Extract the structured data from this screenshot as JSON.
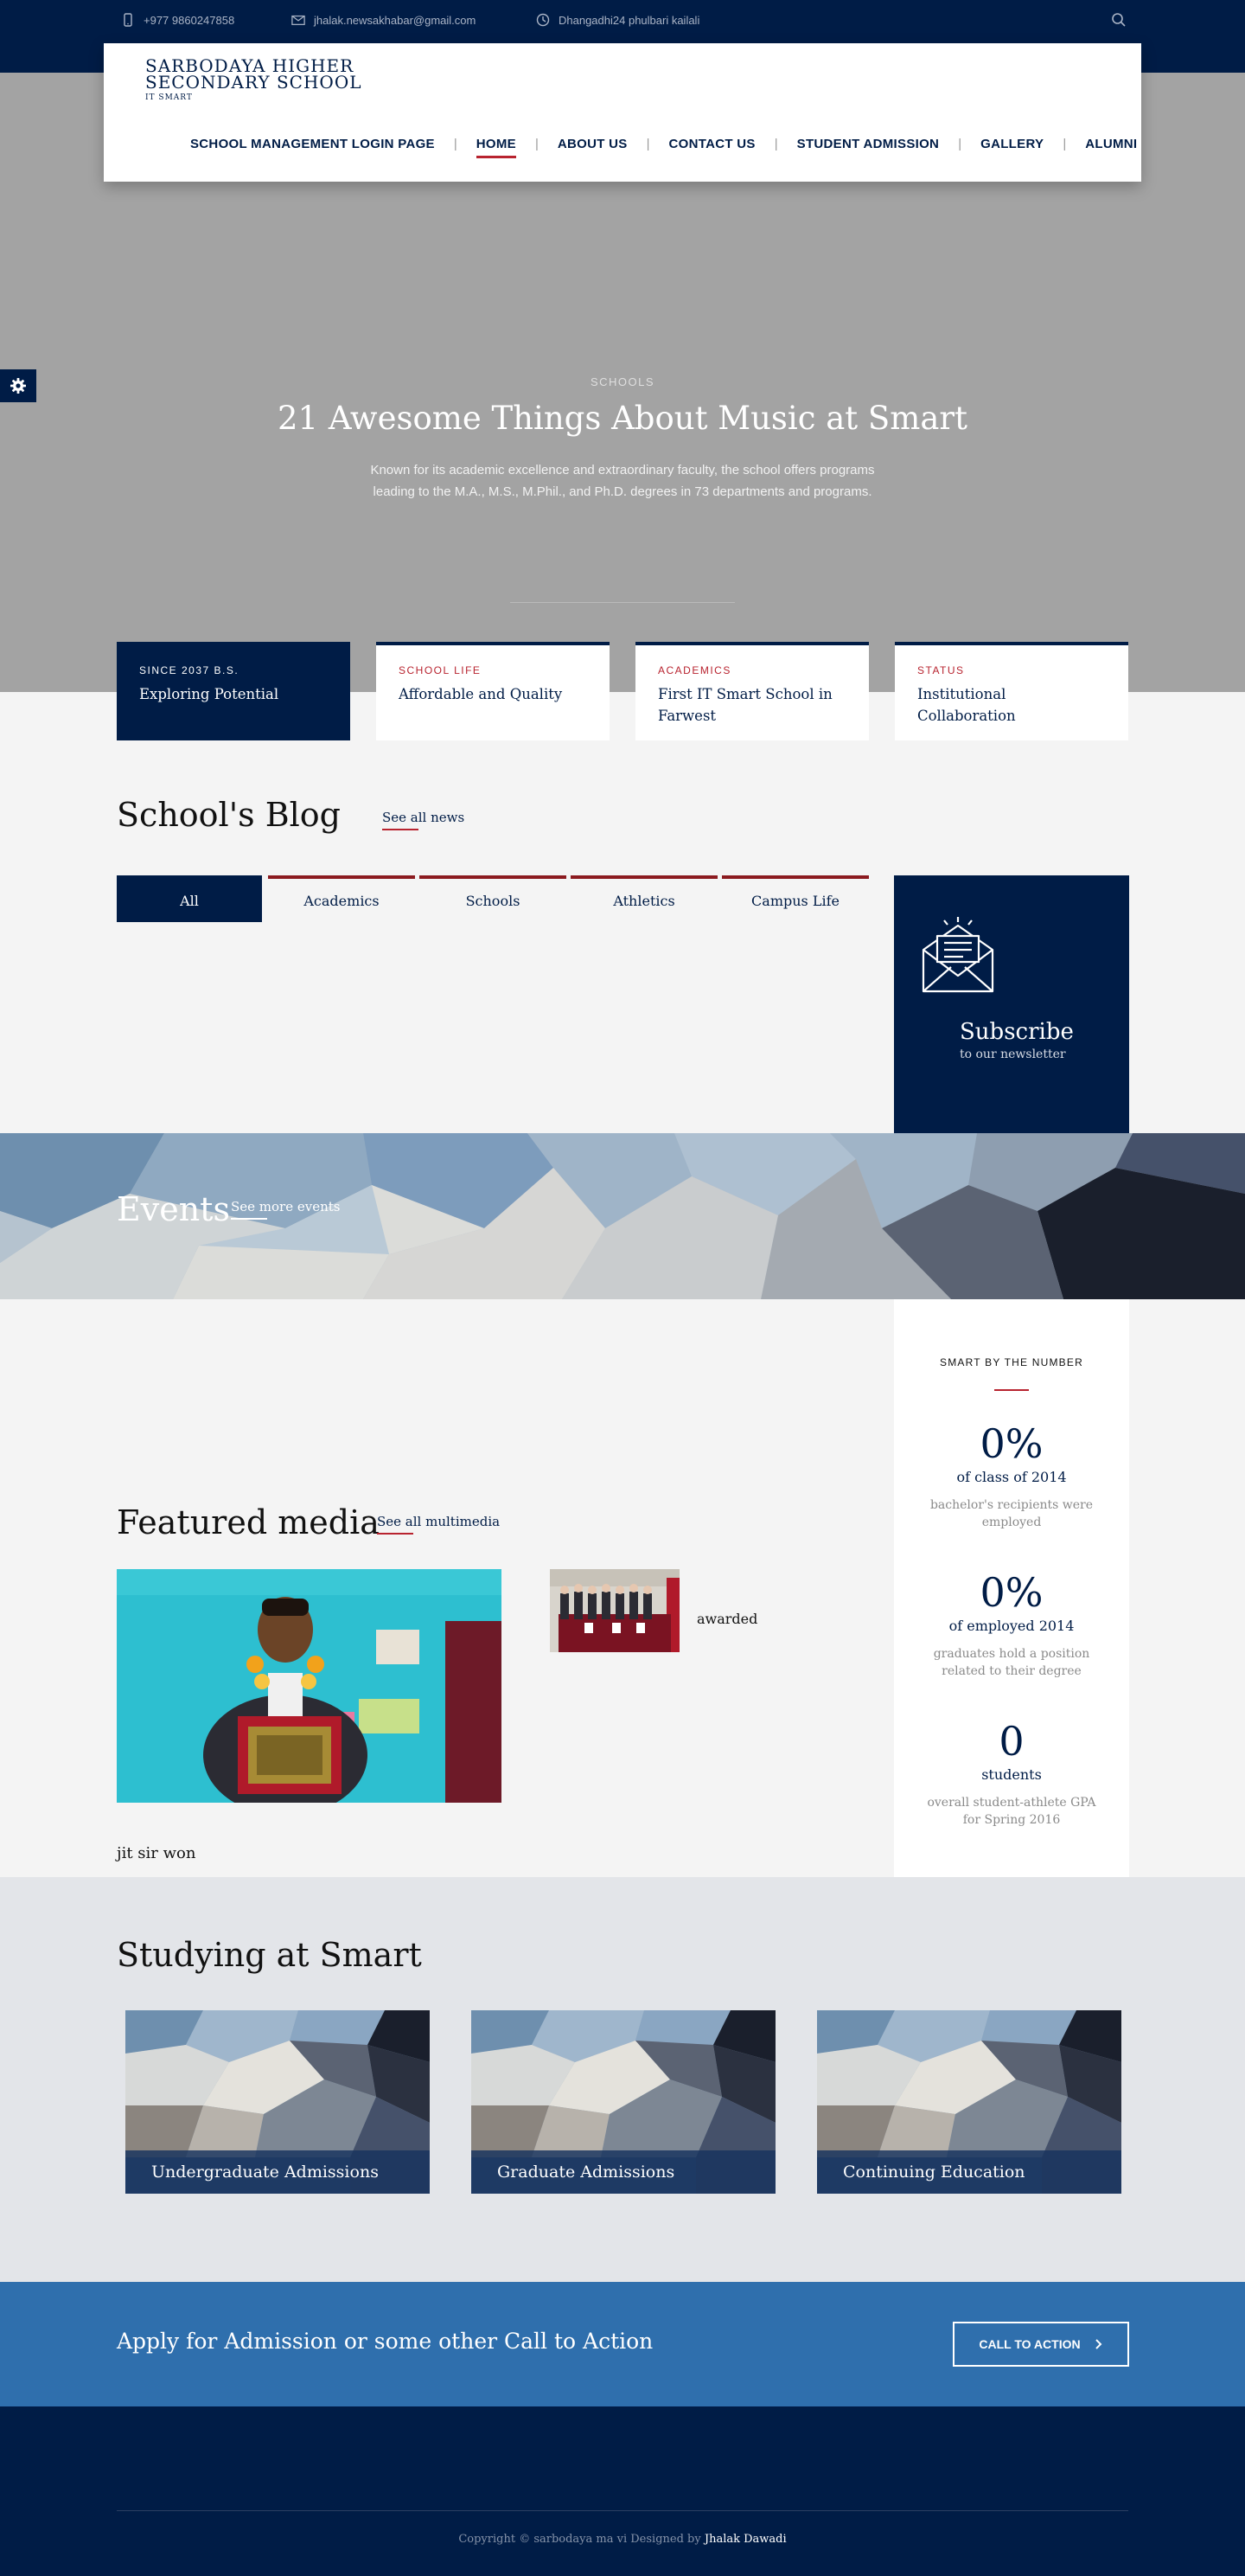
{
  "topbar": {
    "phone": "+977 9860247858",
    "email": "jhalak.newsakhabar@gmail.com",
    "address": "Dhangadhi24 phulbari kailali"
  },
  "logo": {
    "line1": "SARBODAYA HIGHER",
    "line2": "SECONDARY SCHOOL",
    "tagline": "IT SMART"
  },
  "nav": {
    "items": [
      {
        "label": "SCHOOL MANAGEMENT LOGIN PAGE"
      },
      {
        "label": "HOME"
      },
      {
        "label": "ABOUT US"
      },
      {
        "label": "CONTACT US"
      },
      {
        "label": "STUDENT ADMISSION"
      },
      {
        "label": "GALLERY"
      },
      {
        "label": "ALUMNI"
      }
    ],
    "separator": "|"
  },
  "hero": {
    "kicker": "SCHOOLS",
    "title": "21 Awesome Things About Music at Smart",
    "text_line1": "Known for its academic excellence and extraordinary faculty, the school offers programs",
    "text_line2": "leading to the M.A., M.S., M.Phil., and Ph.D. degrees in 73 departments and programs."
  },
  "features": [
    {
      "kicker": "SINCE 2037 B.S.",
      "title": "Exploring Potential"
    },
    {
      "kicker": "SCHOOL LIFE",
      "title": "Affordable and Quality"
    },
    {
      "kicker": "ACADEMICS",
      "title": "First IT Smart School in Farwest"
    },
    {
      "kicker": "STATUS",
      "title": "Institutional Collaboration"
    }
  ],
  "blog": {
    "title": "School's Blog",
    "see_all": "See all news",
    "tabs": [
      {
        "label": "All"
      },
      {
        "label": "Academics"
      },
      {
        "label": "Schools"
      },
      {
        "label": "Athletics"
      },
      {
        "label": "Campus Life"
      }
    ]
  },
  "subscribe": {
    "title": "Subscribe",
    "subtitle": "to our newsletter"
  },
  "events": {
    "title": "Events",
    "see_more": "See more events"
  },
  "media": {
    "title": "Featured media",
    "see_all": "See all multimedia",
    "main_caption": "jit sir won",
    "side_caption": "awarded"
  },
  "stats": {
    "heading": "SMART BY THE NUMBER",
    "items": [
      {
        "number": "0%",
        "label": "of class of 2014",
        "desc1": "bachelor's recipients were",
        "desc2": "employed"
      },
      {
        "number": "0%",
        "label": "of employed 2014",
        "desc1": "graduates hold a position",
        "desc2": "related to their degree"
      },
      {
        "number": "0",
        "label": "students",
        "desc1": "overall student-athlete GPA",
        "desc2": "for Spring 2016"
      }
    ]
  },
  "studying": {
    "title": "Studying at Smart",
    "cards": [
      {
        "label": "Undergraduate Admissions"
      },
      {
        "label": "Graduate Admissions"
      },
      {
        "label": "Continuing Education"
      }
    ]
  },
  "cta": {
    "text": "Apply for Admission or some other Call to Action",
    "button": "CALL TO ACTION"
  },
  "footer": {
    "copyright": "Copyright © sarbodaya ma vi Designed by",
    "designer": "Jhalak Dawadi"
  },
  "colors": {
    "navy": "#001c46",
    "accent_red": "#b8232f",
    "cta_blue": "#2f6fad",
    "hero_gray": "#a3a3a3"
  },
  "icons": [
    "phone-icon",
    "mail-icon",
    "clock-icon",
    "search-icon",
    "gear-icon",
    "envelope-icon",
    "chevron-right-icon"
  ]
}
